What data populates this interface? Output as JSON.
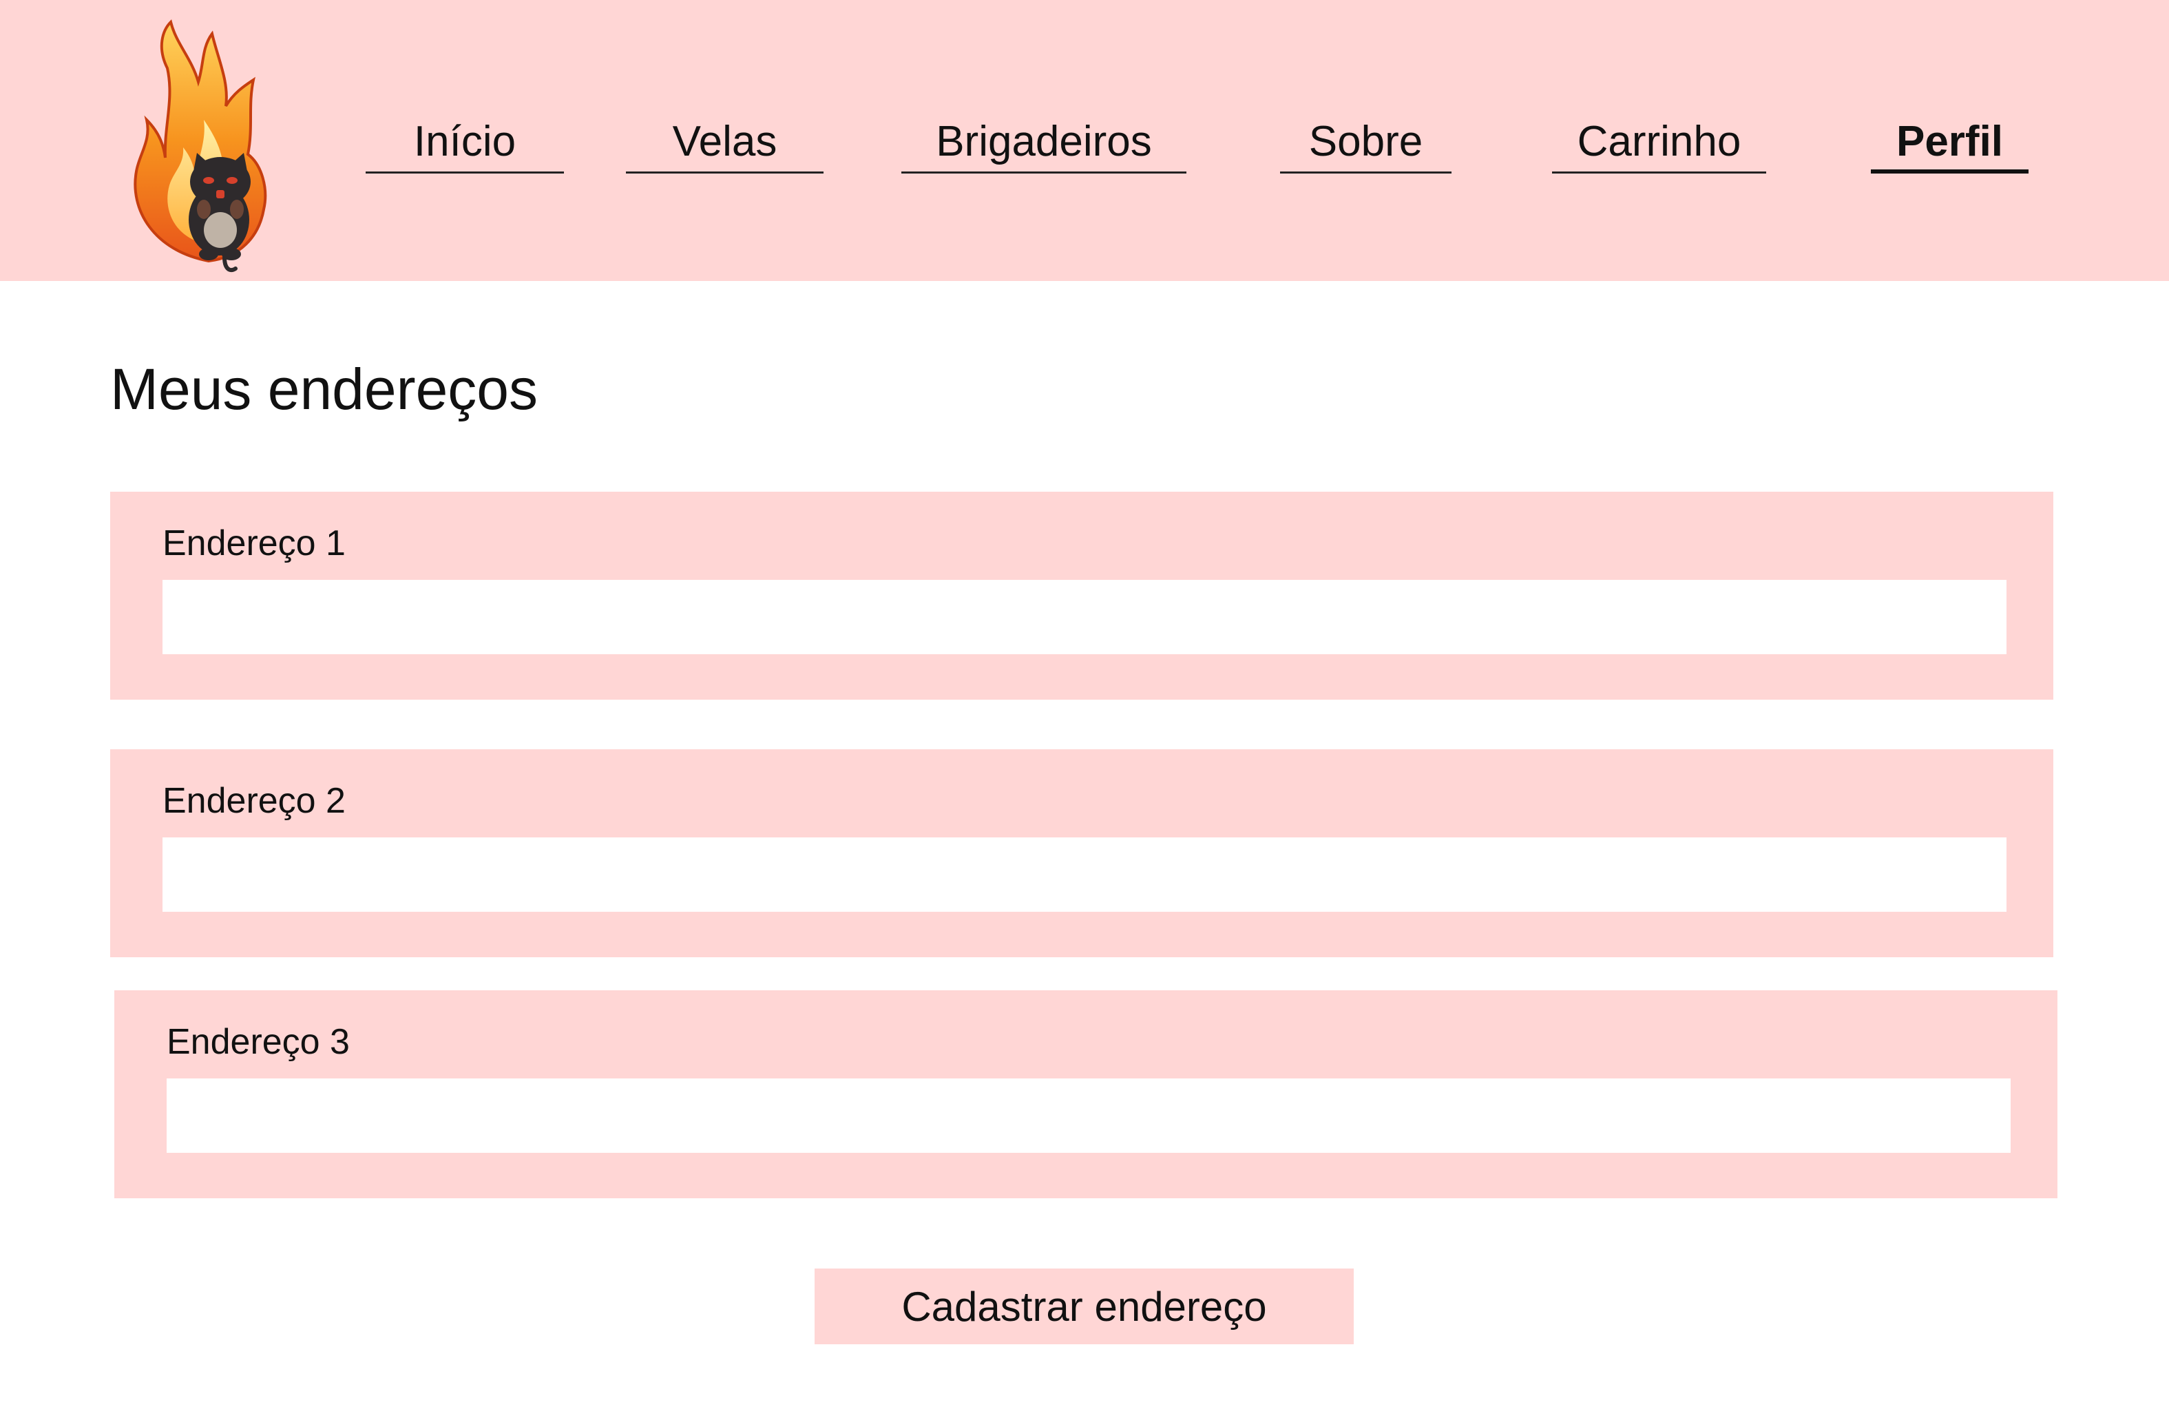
{
  "nav": {
    "items": [
      {
        "label": "Início"
      },
      {
        "label": "Velas"
      },
      {
        "label": "Brigadeiros"
      },
      {
        "label": "Sobre"
      },
      {
        "label": "Carrinho"
      },
      {
        "label": "Perfil",
        "active": true
      }
    ]
  },
  "logo": {
    "icon": "flaming-cat-logo-icon"
  },
  "main": {
    "title": "Meus endereços",
    "addresses": [
      {
        "label": "Endereço 1",
        "value": ""
      },
      {
        "label": "Endereço 2",
        "value": ""
      },
      {
        "label": "Endereço 3",
        "value": ""
      }
    ],
    "submit_label": "Cadastrar endereço"
  },
  "colors": {
    "accent_pink": "#ffd6d5",
    "background": "#ffffff",
    "text": "#111111"
  }
}
